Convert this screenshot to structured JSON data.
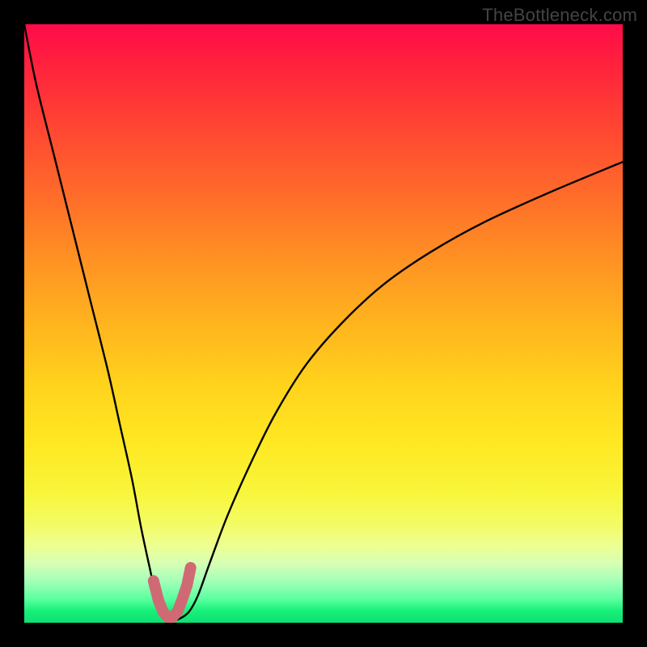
{
  "watermark": "TheBottleneck.com",
  "chart_data": {
    "type": "line",
    "title": "",
    "xlabel": "",
    "ylabel": "",
    "xlim": [
      0,
      100
    ],
    "ylim": [
      0,
      100
    ],
    "grid": false,
    "curve": {
      "x": [
        0,
        2,
        5,
        8,
        11,
        14,
        16,
        18,
        19.5,
        21,
        22,
        23,
        24,
        25,
        26,
        27.5,
        29,
        31,
        34,
        38,
        42,
        47,
        53,
        60,
        68,
        77,
        88,
        100
      ],
      "y": [
        100,
        90,
        78,
        66,
        54,
        42,
        33,
        24,
        16,
        9,
        4.5,
        1.8,
        0.7,
        0.4,
        0.7,
        1.8,
        4.5,
        10,
        18,
        27,
        35,
        43,
        50,
        56.5,
        62,
        67,
        72,
        77
      ]
    },
    "marker_overlay": {
      "color": "#cf6a74",
      "x": [
        21.6,
        22.4,
        23.2,
        24.0,
        24.8,
        25.6,
        26.4,
        27.2,
        27.8
      ],
      "y": [
        7.0,
        3.8,
        1.8,
        0.9,
        0.95,
        1.85,
        3.9,
        6.3,
        9.2
      ]
    },
    "background_gradient": {
      "top_color": "#ff0a4a",
      "bottom_color": "#0ee072"
    }
  }
}
